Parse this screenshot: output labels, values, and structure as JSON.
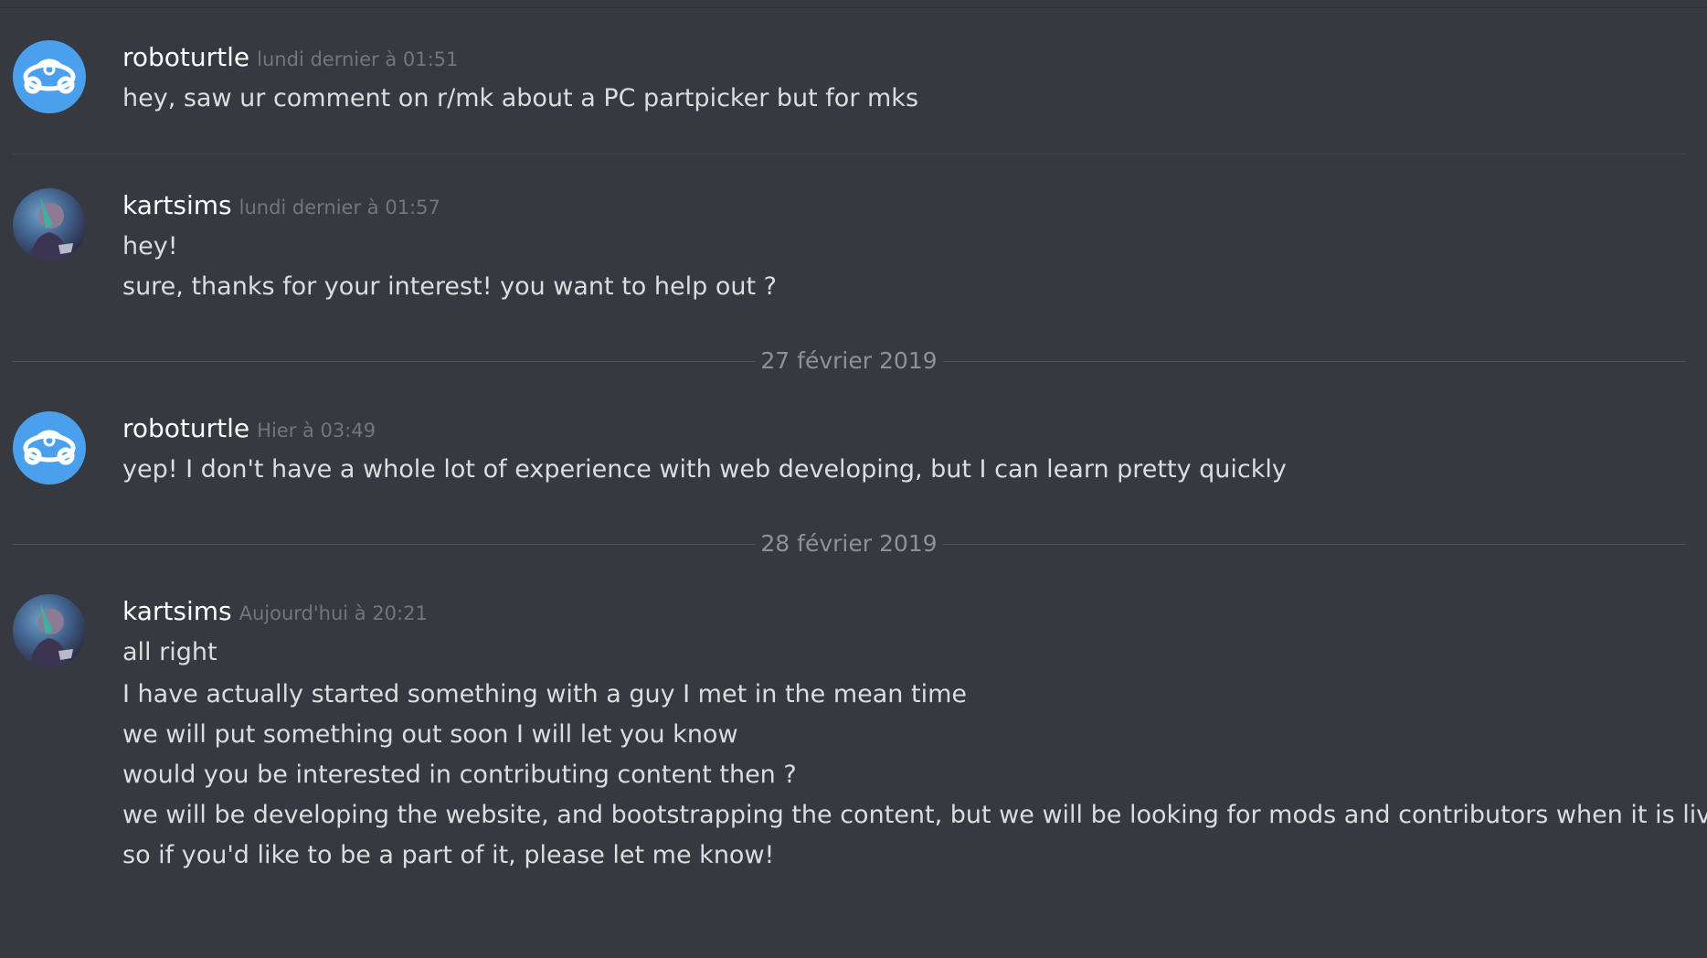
{
  "colors": {
    "background": "#36393f",
    "username": "#ffffff",
    "timestamp": "#72767d",
    "message_text": "#dcddde",
    "bot_avatar": "#4aa0ec",
    "divider": "#4f545c"
  },
  "groups": [
    {
      "author": "roboturtle",
      "avatar_icon": "roboturtle-logo-icon",
      "timestamp": "lundi dernier à 01:51",
      "lines": [
        "hey, saw ur comment on r/mk about a PC partpicker but for mks"
      ]
    },
    {
      "author": "kartsims",
      "avatar_icon": "user-photo-avatar",
      "timestamp": "lundi dernier à 01:57",
      "lines": [
        "hey!",
        "sure, thanks for your interest! you want to help out ?"
      ]
    },
    {
      "author": "roboturtle",
      "avatar_icon": "roboturtle-logo-icon",
      "timestamp": "Hier à 03:49",
      "lines": [
        "yep! I don't have a whole lot of experience with web developing, but I can learn pretty quickly"
      ]
    },
    {
      "author": "kartsims",
      "avatar_icon": "user-photo-avatar",
      "timestamp": "Aujourd'hui à 20:21",
      "lines": [
        "all right",
        "I have actually started something with a guy I met in the mean time",
        "we will put something out soon I will let you know",
        "would you be interested in contributing content then ?",
        "we will be developing the website, and bootstrapping the content, but we will be looking for mods and contributors when it is live",
        "so if you'd like to be a part of it, please let me know!"
      ]
    }
  ],
  "date_dividers": [
    "27 février 2019",
    "28 février 2019"
  ]
}
